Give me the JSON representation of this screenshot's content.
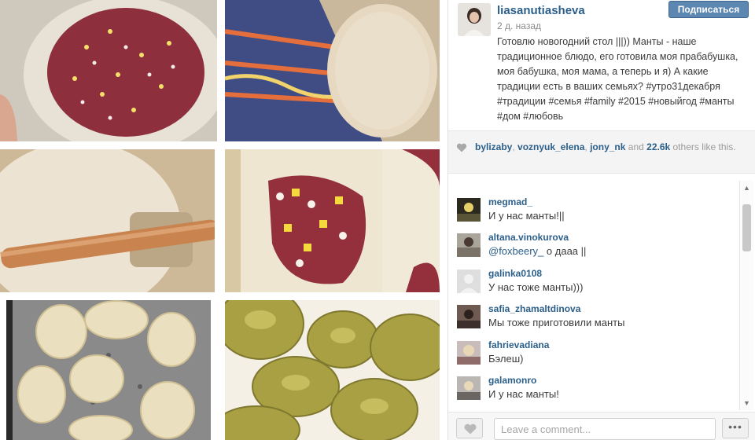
{
  "post": {
    "username": "liasanutiasheva",
    "follow_label": "Подписаться",
    "time": "2 д. назад",
    "caption": "Готовлю новогодний стол |||)) Манты - наше традиционное блюдо, его готовила моя прабабушка, моя бабушка, моя мама, а теперь и я) А какие традиции есть в ваших семьях? #утро31декабря #традиции #семья #family #2015 #новыйгод #манты #дом #любовь"
  },
  "likes": {
    "users": [
      "bylizaby",
      "voznyuk_elena",
      "jony_nk"
    ],
    "sep1": ", ",
    "sep2": ", ",
    "connector": " and ",
    "count": "22.6k",
    "suffix": " others like this."
  },
  "comments": [
    {
      "user": "megmad_",
      "text": "И у нас манты!||"
    },
    {
      "user": "altana.vinokurova",
      "mention": "@foxbeery_",
      "text": " о дааа ||"
    },
    {
      "user": "galinka0108",
      "text": "У нас тоже манты)))"
    },
    {
      "user": "safia_zhamaltdinova",
      "text": "Мы тоже приготовили манты"
    },
    {
      "user": "fahrievadiana",
      "text": "Бэлеш)"
    },
    {
      "user": "galamonro",
      "text": "И у нас манты!"
    }
  ],
  "footer": {
    "comment_placeholder": "Leave a comment...",
    "more_label": "•••"
  },
  "icons": {
    "like": "heart-icon",
    "likes_indicator": "heart-icon",
    "scroll_up": "triangle-up-icon",
    "scroll_down": "triangle-down-icon"
  }
}
